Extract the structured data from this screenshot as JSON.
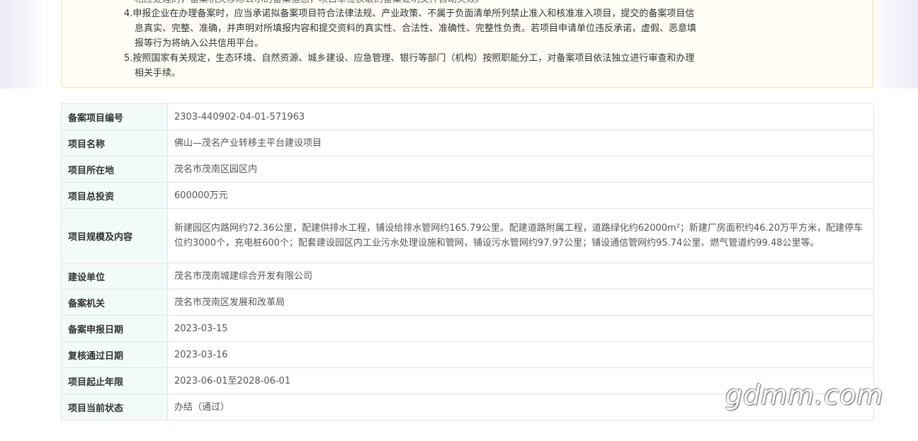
{
  "notice": {
    "line_0": "相应处理的，备案机关移除公示的备案信息，项目单位获取的备案证明文件自动失效。",
    "line_1": "4.申报企业在办理备案时，应当承诺拟备案项目符合法律法规、产业政策、不属于负面清单所列禁止准入和核准准入项目，提交的备案项目信",
    "line_2": "息真实、完整、准确，并声明对所填报内容和提交资料的真实性、合法性、准确性、完整性负责。若项目申请单位违反承诺，虚假、恶意填",
    "line_3": "报等行为将纳入公共信用平台。",
    "line_4": "5.按照国家有关规定，生态环境、自然资源、城乡建设、应急管理、银行等部门（机构）按照职能分工，对备案项目依法独立进行审查和办理",
    "line_5": "相关手续。"
  },
  "rows": [
    {
      "label": "备案项目编号",
      "value": "2303-440902-04-01-571963"
    },
    {
      "label": "项目名称",
      "value": "佛山—茂名产业转移主平台建设项目"
    },
    {
      "label": "项目所在地",
      "value": "茂名市茂南区园区内"
    },
    {
      "label": "项目总投资",
      "value": "600000万元"
    },
    {
      "label": "项目规模及内容",
      "value": "新建园区内路网约72.36公里，配建供排水工程，铺设给排水管网约165.79公里。配建道路附属工程，道路绿化约62000m²；新建厂房面积约46.20万平方米，配建停车位约3000个，充电桩600个；配套建设园区内工业污水处理设施和管网，铺设污水管网约97.97公里；铺设通信管网约95.74公里、燃气管道约99.48公里等。"
    },
    {
      "label": "建设单位",
      "value": "茂名市茂南城建综合开发有限公司"
    },
    {
      "label": "备案机关",
      "value": "茂名市茂南区发展和改革局"
    },
    {
      "label": "备案申报日期",
      "value": "2023-03-15"
    },
    {
      "label": "复核通过日期",
      "value": "2023-03-16"
    },
    {
      "label": "项目起止年限",
      "value": "2023-06-01至2028-06-01"
    },
    {
      "label": "项目当前状态",
      "value": "办结（通过）"
    }
  ],
  "watermark": "gdmm.com"
}
